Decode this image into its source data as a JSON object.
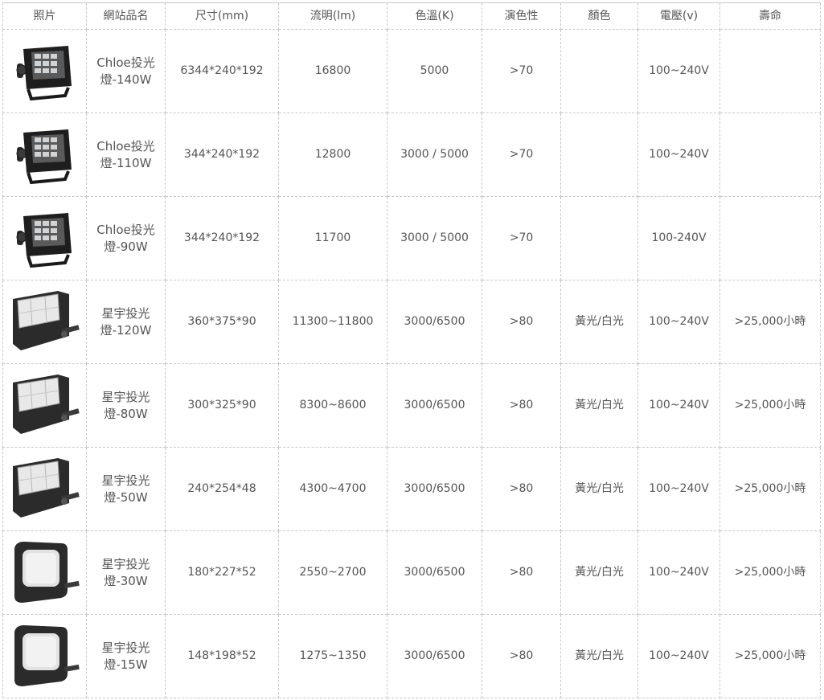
{
  "headers": [
    "照片",
    "網站品名",
    "尺寸(mm)",
    "流明(lm)",
    "色溫(K)",
    "演色性",
    "顏色",
    "電壓(v)",
    "壽命"
  ],
  "rows": [
    {
      "icon": "chloe-floodlight-icon",
      "name_l1": "Chloe投光",
      "name_l2": "燈-140W",
      "size": "6344*240*192",
      "lumen": "16800",
      "cct": "5000",
      "cri": ">70",
      "color": "",
      "voltage": "100~240V",
      "life": ""
    },
    {
      "icon": "chloe-floodlight-icon",
      "name_l1": "Chloe投光",
      "name_l2": "燈-110W",
      "size": "344*240*192",
      "lumen": "12800",
      "cct": "3000 / 5000",
      "cri": ">70",
      "color": "",
      "voltage": "100~240V",
      "life": ""
    },
    {
      "icon": "chloe-floodlight-icon",
      "name_l1": "Chloe投光",
      "name_l2": "燈-90W",
      "size": "344*240*192",
      "lumen": "11700",
      "cct": "3000 / 5000",
      "cri": ">70",
      "color": "",
      "voltage": "100-240V",
      "life": ""
    },
    {
      "icon": "star-floodlight-icon",
      "name_l1": "星宇投光",
      "name_l2": "燈-120W",
      "size": "360*375*90",
      "lumen": "11300~11800",
      "cct": "3000/6500",
      "cri": ">80",
      "color": "黃光/白光",
      "voltage": "100~240V",
      "life": ">25,000小時"
    },
    {
      "icon": "star-floodlight-icon",
      "name_l1": "星宇投光",
      "name_l2": "燈-80W",
      "size": "300*325*90",
      "lumen": "8300~8600",
      "cct": "3000/6500",
      "cri": ">80",
      "color": "黃光/白光",
      "voltage": "100~240V",
      "life": ">25,000小時"
    },
    {
      "icon": "star-floodlight-icon",
      "name_l1": "星宇投光",
      "name_l2": "燈-50W",
      "size": "240*254*48",
      "lumen": "4300~4700",
      "cct": "3000/6500",
      "cri": ">80",
      "color": "黃光/白光",
      "voltage": "100~240V",
      "life": ">25,000小時"
    },
    {
      "icon": "small-floodlight-icon",
      "name_l1": "星宇投光",
      "name_l2": "燈-30W",
      "size": "180*227*52",
      "lumen": "2550~2700",
      "cct": "3000/6500",
      "cri": ">80",
      "color": "黃光/白光",
      "voltage": "100~240V",
      "life": ">25,000小時"
    },
    {
      "icon": "small-floodlight-icon",
      "name_l1": "星宇投光",
      "name_l2": "燈-15W",
      "size": "148*198*52",
      "lumen": "1275~1350",
      "cct": "3000/6500",
      "cri": ">80",
      "color": "黃光/白光",
      "voltage": "100~240V",
      "life": ">25,000小時"
    }
  ]
}
